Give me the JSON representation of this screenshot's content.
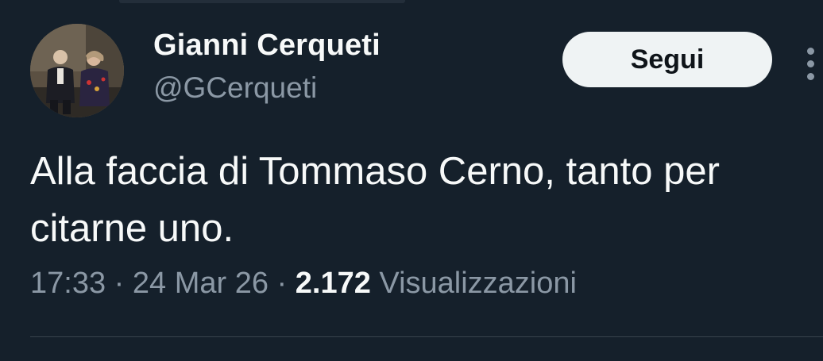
{
  "tweet": {
    "author": {
      "display_name": "Gianni Cerqueti",
      "handle": "@GCerqueti",
      "avatar_icon": "profile-photo"
    },
    "follow_button_label": "Segui",
    "more_icon": "more-vertical-icon",
    "text_lines": [
      "Alla faccia di Tommaso Cerno, tanto per",
      "citarne uno."
    ],
    "meta": {
      "time": "17:33",
      "separator": " · ",
      "date": "24 Mar 26",
      "views_count": "2.172",
      "views_label": "Visualizzazioni"
    }
  },
  "colors": {
    "background": "#15202b",
    "primary_text": "#f7f9f9",
    "secondary_text": "#8b98a5",
    "button_bg": "#eff3f4",
    "button_text": "#0f1419",
    "divider": "#38444d"
  }
}
